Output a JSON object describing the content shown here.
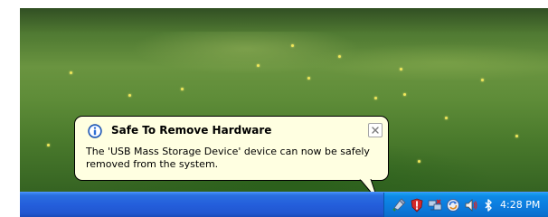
{
  "balloon": {
    "title": "Safe To Remove Hardware",
    "message": "The 'USB Mass Storage Device' device can now be safely removed from the system.",
    "icon": "info-icon",
    "close_icon": "close-icon"
  },
  "taskbar": {
    "tray_icons": [
      "safely-remove-hardware-icon",
      "security-shield-icon",
      "network-connection-icon",
      "update-icon",
      "volume-icon",
      "bluetooth-icon"
    ],
    "clock": "4:28 PM"
  },
  "colors": {
    "balloon_bg": "#ffffe1",
    "taskbar_blue": "#245edb",
    "tray_blue": "#0c7ddf"
  }
}
